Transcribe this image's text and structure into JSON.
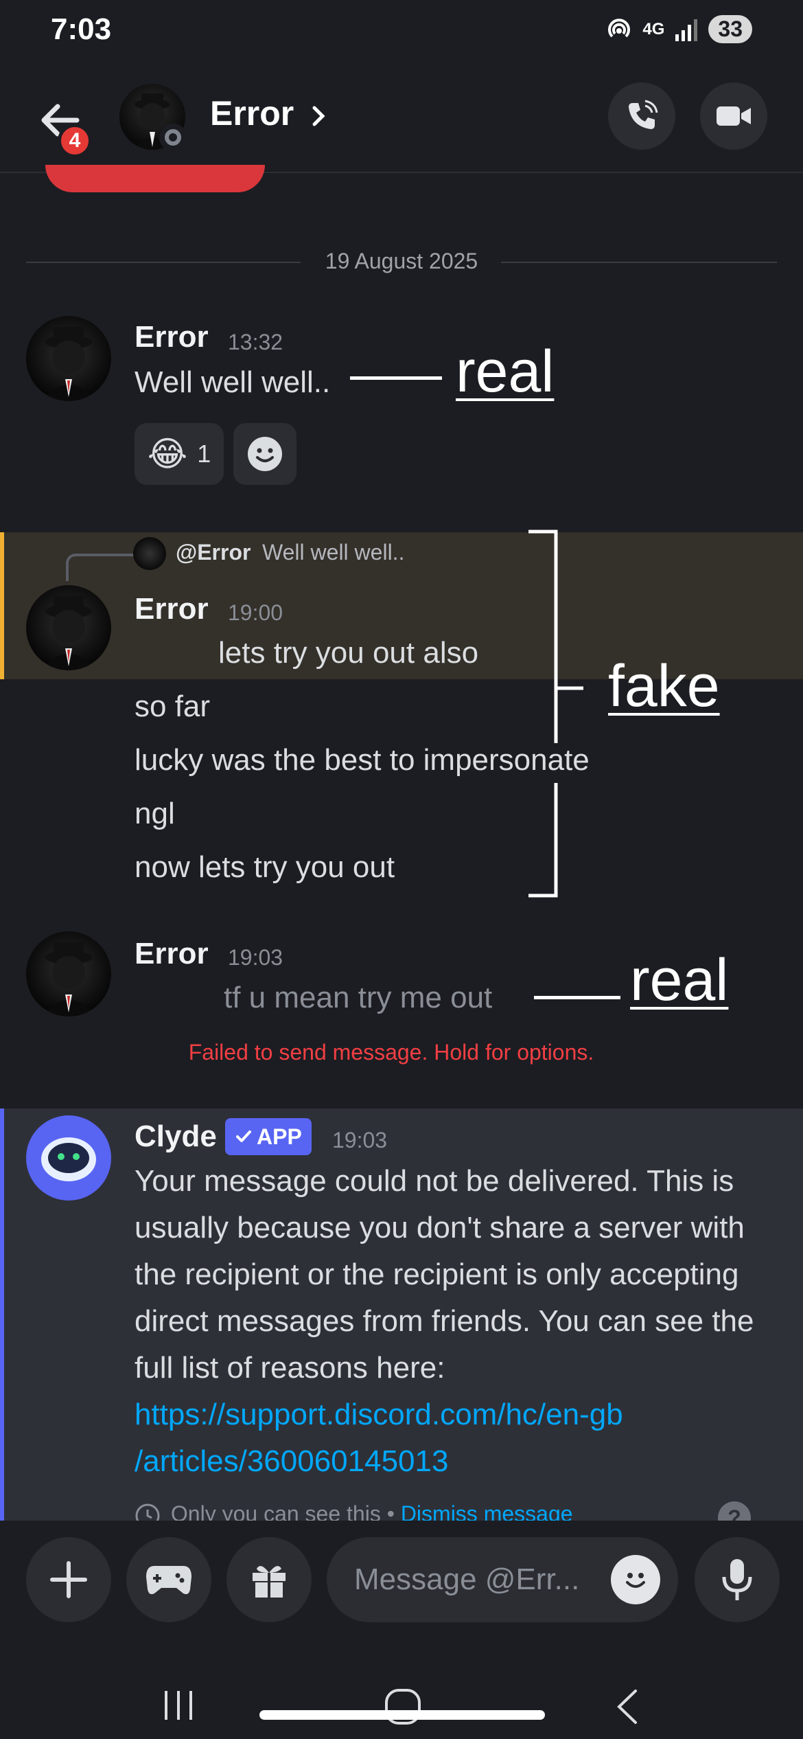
{
  "status_bar": {
    "time": "7:03",
    "network": "4G",
    "battery": "33"
  },
  "header": {
    "notification_count": "4",
    "contact_name": "Error"
  },
  "date_divider": "19 August 2025",
  "messages": [
    {
      "author": "Error",
      "time": "13:32",
      "text": "Well well well..",
      "reaction": {
        "emoji": "😂",
        "count": "1"
      }
    },
    {
      "author": "Error",
      "time": "19:00",
      "reply_to_user": "@Error",
      "reply_to_text": "Well well well..",
      "lines": [
        "lets try you out also",
        "so far",
        "lucky was the best to impersonate",
        "ngl",
        "now lets try you out"
      ]
    },
    {
      "author": "Error",
      "time": "19:03",
      "text": "tf u mean try me out",
      "error": "Failed to send message. Hold for options."
    }
  ],
  "clyde": {
    "author": "Clyde",
    "badge": "APP",
    "time": "19:03",
    "text": "Your message could not be delivered. This is usually because you don't share a server with the recipient or the recipient is only accepting direct messages from friends. You can see the full list of reasons here:",
    "link_line1": "https://support.discord.com/hc/en-gb",
    "link_line2": "/articles/360060145013",
    "footer_text": "Only you can see this • ",
    "footer_dismiss": "Dismiss message",
    "help": "?"
  },
  "annotations": {
    "real_top": "real",
    "fake": "fake",
    "real_bottom": "real"
  },
  "composer": {
    "placeholder": "Message @Err..."
  }
}
